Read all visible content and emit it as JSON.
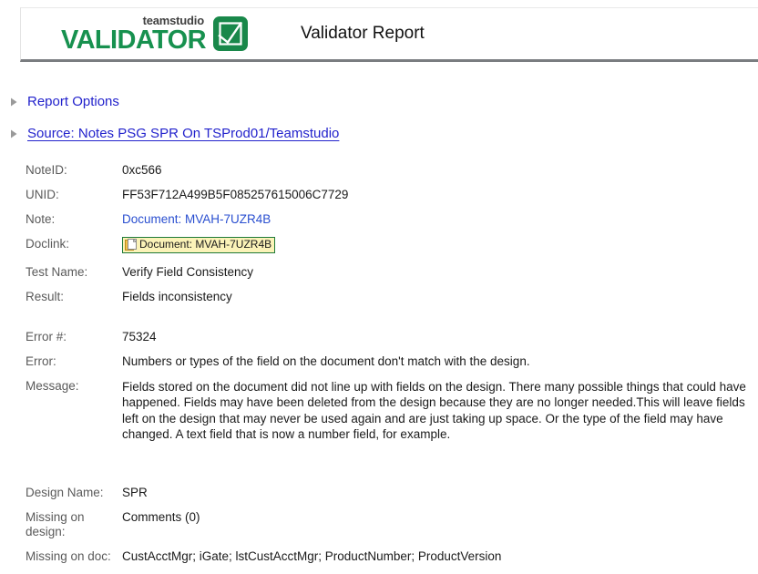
{
  "header": {
    "logo": {
      "brand_small": "teamstudio",
      "brand_large": "VALIDATOR",
      "check_icon": "checkbox-check-icon",
      "brand_green": "#17914f"
    },
    "title": "Validator Report"
  },
  "disclosures": [
    {
      "label": "Report Options",
      "icon": "triangle-right-icon",
      "expanded": false
    },
    {
      "label": "Source: Notes PSG SPR On TSProd01/Teamstudio ",
      "icon": "triangle-right-icon",
      "expanded": false
    }
  ],
  "fields": {
    "note_id": {
      "label": "NoteID:",
      "value": "0xc566"
    },
    "unid": {
      "label": "UNID:",
      "value": "FF53F712A499B5F085257615006C7729"
    },
    "note": {
      "label": "Note:",
      "value": "Document: MVAH-7UZR4B"
    },
    "doclink": {
      "label": "Doclink:",
      "value": "Document: MVAH-7UZR4B",
      "icon": "document-icon"
    },
    "test_name": {
      "label": "Test Name:",
      "value": "Verify Field Consistency"
    },
    "result": {
      "label": "Result:",
      "value": "Fields inconsistency"
    },
    "error_number": {
      "label": "Error #:",
      "value": "75324"
    },
    "error": {
      "label": "Error:",
      "value": "Numbers or types of the field on the document don't match with the design."
    },
    "message": {
      "label": "Message:",
      "value": "Fields stored on the document did not line up with fields on the design. There many possible things that could have happened. Fields may have been deleted from the design because they are no longer needed.This will leave fields left on the design that may never be used again and are just taking up space. Or the type of the field may have changed. A text field that is now a number field, for example."
    },
    "design_name": {
      "label": "Design Name:",
      "value": "SPR"
    },
    "missing_on_design": {
      "label": "Missing on design:",
      "value": "Comments (0)"
    },
    "missing_on_doc": {
      "label": "Missing on doc:",
      "value": "CustAcctMgr; iGate; lstCustAcctMgr; ProductNumber; ProductVersion"
    }
  }
}
